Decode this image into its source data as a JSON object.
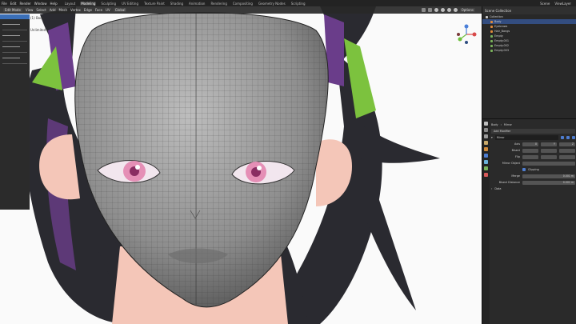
{
  "menu": [
    "File",
    "Edit",
    "Render",
    "Window",
    "Help"
  ],
  "workspaces": [
    {
      "label": "Layout",
      "active": false
    },
    {
      "label": "Modeling",
      "active": true
    },
    {
      "label": "Sculpting",
      "active": false
    },
    {
      "label": "UV Editing",
      "active": false
    },
    {
      "label": "Texture Paint",
      "active": false
    },
    {
      "label": "Shading",
      "active": false
    },
    {
      "label": "Animation",
      "active": false
    },
    {
      "label": "Rendering",
      "active": false
    },
    {
      "label": "Compositing",
      "active": false
    },
    {
      "label": "Geometry Nodes",
      "active": false
    },
    {
      "label": "Scripting",
      "active": false
    }
  ],
  "top_right": {
    "scene": "Scene",
    "view_layer": "ViewLayer"
  },
  "viewport_header": {
    "mode": "Edit Mode",
    "menus": [
      "View",
      "Select",
      "Add",
      "Mesh",
      "Vertex",
      "Edge",
      "Face",
      "UV"
    ],
    "orientation": "Global",
    "options": "Options"
  },
  "tool_panel": {
    "object_label": "(1) Body",
    "subtitle": "Unlimited"
  },
  "outliner": {
    "title": "Scene Collection",
    "rows": [
      {
        "label": "Collection",
        "selected": false,
        "icon": "collection-icon"
      },
      {
        "label": "Body",
        "selected": true,
        "icon": "mesh-icon"
      },
      {
        "label": "Eyebrows",
        "selected": false,
        "icon": "mesh-icon"
      },
      {
        "label": "Hair_Bangs",
        "selected": false,
        "icon": "mesh-icon"
      },
      {
        "label": "Empty",
        "selected": false,
        "icon": "empty-icon"
      },
      {
        "label": "Empty.001",
        "selected": false,
        "icon": "empty-icon"
      },
      {
        "label": "Empty.002",
        "selected": false,
        "icon": "empty-icon"
      },
      {
        "label": "Empty.003",
        "selected": false,
        "icon": "empty-icon"
      }
    ]
  },
  "properties": {
    "breadcrumb_object": "Body",
    "breadcrumb_modifier": "Mirror",
    "add_modifier": "Add Modifier",
    "modifier_name": "Mirror",
    "axis_label": "Axis",
    "bisect_label": "Bisect",
    "flip_label": "Flip",
    "axis_values": [
      "X",
      "Y",
      "Z"
    ],
    "mirror_object_label": "Mirror Object",
    "clipping_label": "Clipping",
    "merge_label": "Merge",
    "merge_value": "0.001 m",
    "bisect_distance_label": "Bisect Distance",
    "bisect_distance_value": "0.001 m",
    "data_label": "Data"
  },
  "colors": {
    "accent": "#4e7dd0",
    "selection": "#334d80",
    "viewport_bg": "#fafafa",
    "mesh_gray": "#8e8e8e",
    "hair": "#2a2a30",
    "hair_purple": "#6a3d8a",
    "ribbon_green": "#7cc23e",
    "skin": "#f4c6b8",
    "eye_pink": "#e58fb6"
  }
}
